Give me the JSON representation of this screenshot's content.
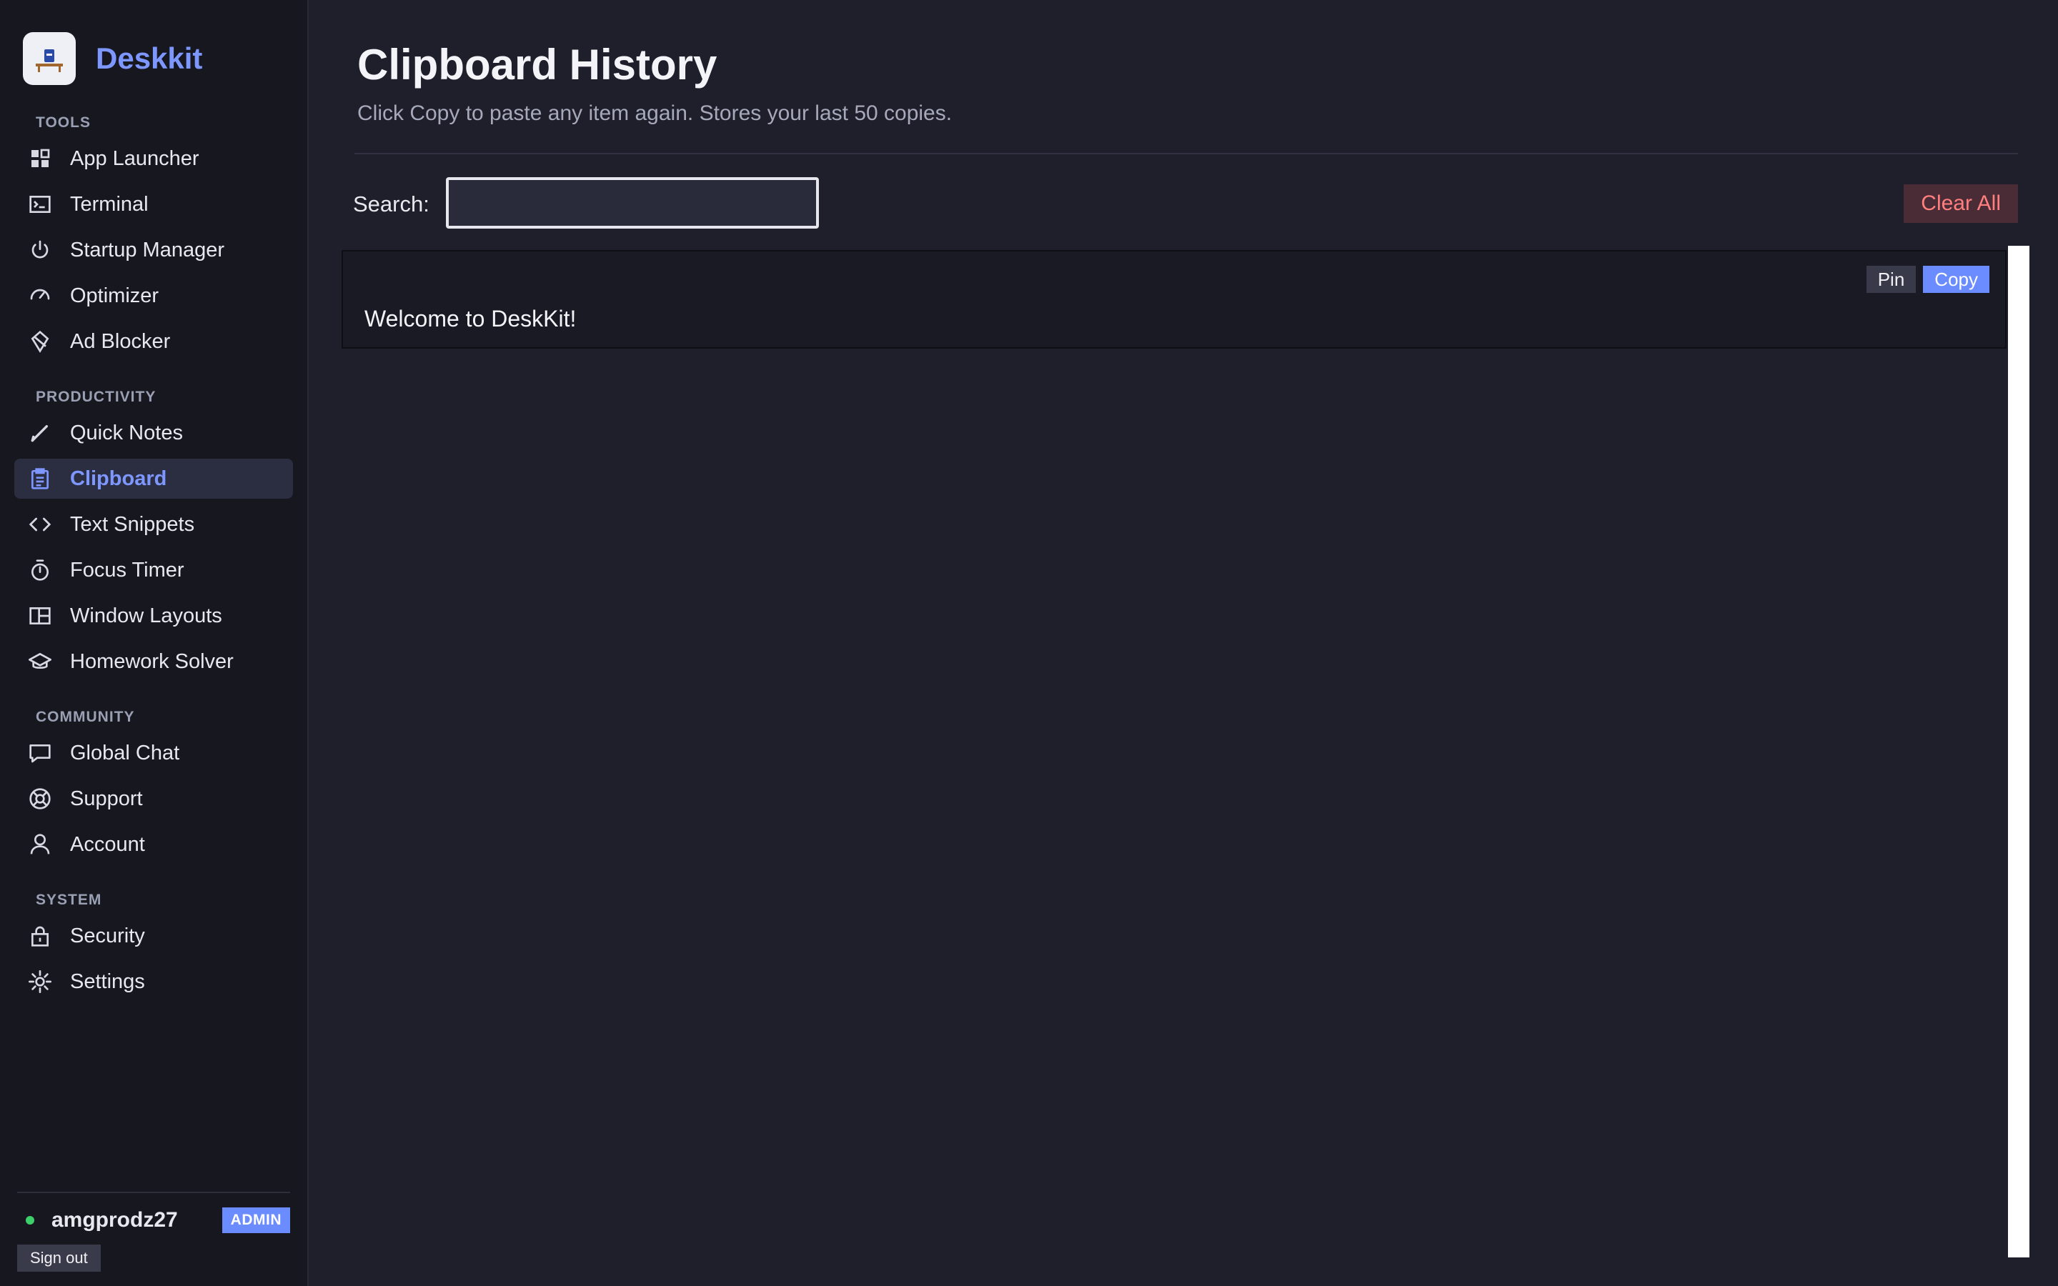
{
  "app": {
    "name": "Deskkit"
  },
  "sidebar": {
    "sections": [
      {
        "label": "TOOLS",
        "items": [
          {
            "label": "App Launcher",
            "icon": "grid-icon"
          },
          {
            "label": "Terminal",
            "icon": "terminal-icon"
          },
          {
            "label": "Startup Manager",
            "icon": "power-icon"
          },
          {
            "label": "Optimizer",
            "icon": "gauge-icon"
          },
          {
            "label": "Ad Blocker",
            "icon": "shield-block-icon"
          }
        ]
      },
      {
        "label": "PRODUCTIVITY",
        "items": [
          {
            "label": "Quick Notes",
            "icon": "pen-icon"
          },
          {
            "label": "Clipboard",
            "icon": "clipboard-icon",
            "active": true
          },
          {
            "label": "Text Snippets",
            "icon": "code-icon"
          },
          {
            "label": "Focus Timer",
            "icon": "stopwatch-icon"
          },
          {
            "label": "Window Layouts",
            "icon": "layout-icon"
          },
          {
            "label": "Homework Solver",
            "icon": "graduation-cap-icon"
          }
        ]
      },
      {
        "label": "COMMUNITY",
        "items": [
          {
            "label": "Global Chat",
            "icon": "chat-icon"
          },
          {
            "label": "Support",
            "icon": "lifebuoy-icon"
          },
          {
            "label": "Account",
            "icon": "user-icon"
          }
        ]
      },
      {
        "label": "SYSTEM",
        "items": [
          {
            "label": "Security",
            "icon": "lock-icon"
          },
          {
            "label": "Settings",
            "icon": "gear-icon"
          }
        ]
      }
    ],
    "user": {
      "name": "amgprodz27",
      "role": "ADMIN",
      "status_color": "#3ccf6a"
    },
    "signout_label": "Sign out"
  },
  "main": {
    "title": "Clipboard History",
    "subtitle": "Click Copy to paste any item again. Stores your last 50 copies.",
    "search": {
      "label": "Search:",
      "value": "",
      "placeholder": ""
    },
    "clear_all_label": "Clear All",
    "items": [
      {
        "text": "Welcome to DeskKit!",
        "pin_label": "Pin",
        "copy_label": "Copy"
      }
    ]
  },
  "colors": {
    "accent": "#6a8cff",
    "brand": "#7d97ff",
    "danger": "#ff7f7f",
    "background": "#1f1f2c",
    "sidebar": "#17171f"
  }
}
